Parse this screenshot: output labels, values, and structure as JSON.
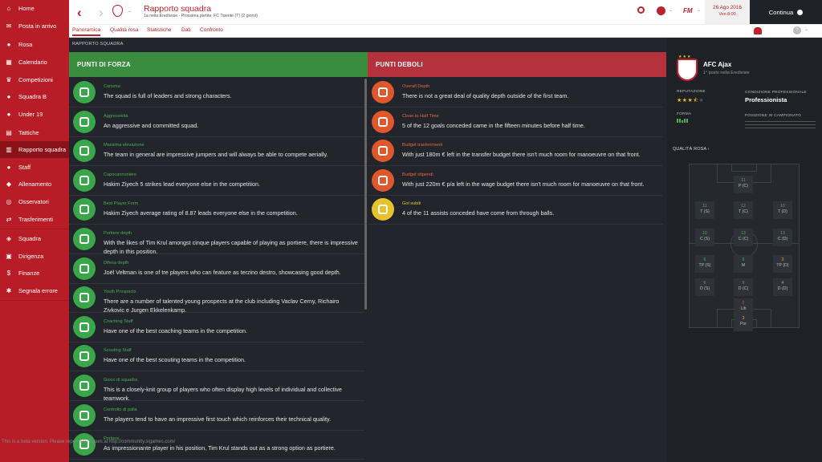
{
  "sidebar": {
    "items": [
      {
        "label": "Home",
        "icon": "home-icon"
      },
      {
        "label": "Posta in arrivo",
        "icon": "mail-icon"
      },
      {
        "label": "Rosa",
        "icon": "person-icon"
      },
      {
        "label": "Calendario",
        "icon": "calendar-icon"
      },
      {
        "label": "Competizioni",
        "icon": "trophy-icon"
      },
      {
        "label": "Squadra B",
        "icon": "people-icon"
      },
      {
        "label": "Under 19",
        "icon": "people-icon"
      },
      {
        "label": "Tattiche",
        "icon": "tactics-icon"
      },
      {
        "label": "Rapporto squadra",
        "icon": "report-icon"
      },
      {
        "label": "Staff",
        "icon": "staff-icon"
      },
      {
        "label": "Allenamento",
        "icon": "training-icon"
      },
      {
        "label": "Osservatori",
        "icon": "binoculars-icon"
      },
      {
        "label": "Trasferimenti",
        "icon": "transfer-icon"
      },
      {
        "label": "Squadra",
        "icon": "shield-icon"
      },
      {
        "label": "Dirigenza",
        "icon": "board-icon"
      },
      {
        "label": "Finanze",
        "icon": "finance-icon"
      },
      {
        "label": "Segnala errore",
        "icon": "bug-icon"
      }
    ]
  },
  "header": {
    "title": "Rapporto squadra",
    "subtitle": "1a nella Eredivisie - Prossima partita: FC Twente (T) (2 giorni)",
    "logo_text": "FM",
    "date": "26 Ago 2016",
    "time": "Ven 8:00",
    "continue_label": "Continua"
  },
  "tabs": [
    "Panoramica",
    "Qualità rosa",
    "Statistiche",
    "Dati",
    "Confronto"
  ],
  "breadcrumb": "RAPPORTO SQUADRA",
  "strengths": {
    "title": "PUNTI DI FORZA",
    "items": [
      {
        "title": "Carisma",
        "desc": "The squad is full of leaders and strong characters."
      },
      {
        "title": "Aggressività",
        "desc": "An aggressive and committed squad."
      },
      {
        "title": "Massima elevazione",
        "desc": "The team in general are impressive jumpers and will always be able to compete aerially."
      },
      {
        "title": "Capocannoniere",
        "desc": "Hakim Ziyech 5 strikes lead everyone else in the competition."
      },
      {
        "title": "Best Player Form",
        "desc": "Hakim Ziyech average rating of 8.87 leads everyone else in the competition."
      },
      {
        "title": "Portiere depth",
        "desc": "With the likes of Tim Krul amongst cinque players capable of playing as portiere, there is impressive depth in this position."
      },
      {
        "title": "Difesa depth",
        "desc": "Joël Veltman is one of tre players who can feature as terzino destro, showcasing good depth."
      },
      {
        "title": "Youth Prospects",
        "desc": "There are a number of talented young prospects at the club including Vaclav Cerny, Richairo Zivkovic e Jurgen Ekkelenkamp."
      },
      {
        "title": "Coaching Staff",
        "desc": "Have one of the best coaching teams in the competition."
      },
      {
        "title": "Scouting Staff",
        "desc": "Have one of the best scouting teams in the competition."
      },
      {
        "title": "Gioco di squadra",
        "desc": "This is a closely-knit group of players who often display high levels of individual and collective teamwork."
      },
      {
        "title": "Controllo di palla",
        "desc": "The players tend to have an impressive first touch which reinforces their technical quality."
      },
      {
        "title": "Portiere",
        "desc": "As impressionante player in his position, Tim Krul stands out as a strong option as portiere."
      }
    ]
  },
  "weaknesses": {
    "title": "PUNTI DEBOLI",
    "items": [
      {
        "title": "Overall Depth",
        "desc": "There is not a great deal of quality depth outside of the first team."
      },
      {
        "title": "Close to Half Time",
        "desc": "5 of the 12 goals conceded came in the fifteen minutes before half time."
      },
      {
        "title": "Budget trasferimenti",
        "desc": "With just 180m € left in the transfer budget there isn't much room for manoeuvre on that front."
      },
      {
        "title": "Budget stipendi",
        "desc": "With just 220m € p/a left in the wage budget there isn't much room for manoeuvre on that front."
      },
      {
        "title": "Gol subiti",
        "desc": "4 of the 11 assists conceded have come from through balls."
      }
    ]
  },
  "club": {
    "name": "AFC Ajax",
    "position": "1° posto nella Eredivisie",
    "reputation_label": "REPUTAZIONE",
    "reputation_stars": 3.5,
    "status_label": "CONDIZIONE PROFESSIONALE",
    "status_value": "Professionista",
    "form_label": "FORMA",
    "league_pos_label": "POSIZIONE IN CAMPIONATO",
    "squad_quality_label": "QUALITÀ ROSA"
  },
  "pitch_positions": [
    {
      "n": "11",
      "p": "P (C)",
      "c": "#4caf50"
    },
    {
      "n": "11",
      "p": "T (S)",
      "c": "#4caf50"
    },
    {
      "n": "12",
      "p": "T (C)",
      "c": "#4caf50"
    },
    {
      "n": "10",
      "p": "T (D)",
      "c": "#4caf50"
    },
    {
      "n": "10",
      "p": "C (S)",
      "c": "#4caf50"
    },
    {
      "n": "13",
      "p": "C (C)",
      "c": "#4caf50"
    },
    {
      "n": "13",
      "p": "C (D)",
      "c": "#4caf50"
    },
    {
      "n": "6",
      "p": "TP (S)",
      "c": "#4caf50"
    },
    {
      "n": "9",
      "p": "M",
      "c": "#4caf50"
    },
    {
      "n": "3",
      "p": "TP (D)",
      "c": "#e8a030"
    },
    {
      "n": "6",
      "p": "D (S)",
      "c": "#4caf50"
    },
    {
      "n": "9",
      "p": "D (C)",
      "c": "#4caf50"
    },
    {
      "n": "4",
      "p": "D (D)",
      "c": "#e8a030"
    },
    {
      "n": "2",
      "p": "Lib",
      "c": "#e0402c"
    },
    {
      "n": "3",
      "p": "Por",
      "c": "#e8a030"
    }
  ],
  "footer_note": "This is a beta version. Please report any issues at http://community.sigames.com/"
}
